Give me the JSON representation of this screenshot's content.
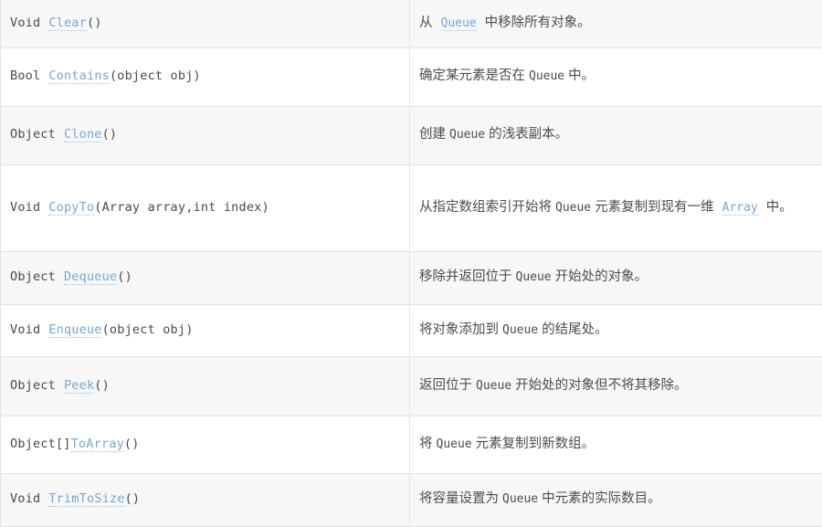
{
  "table": {
    "columns": [
      {
        "key": "signature",
        "header_visible": false
      },
      {
        "key": "description",
        "header_visible": false
      }
    ],
    "link_color": "#7aa6cf",
    "shaded_row_color": "#f7f7f7",
    "plain_row_color": "#ffffff",
    "border_color": "#e3e3e3",
    "rows": [
      {
        "return_type": "Void",
        "method_name": "Clear",
        "params": "()",
        "desc_prefix": "从",
        "desc_link": "Queue",
        "desc_suffix": "中移除所有对象。",
        "shaded": true
      },
      {
        "return_type": "Bool",
        "method_name": "Contains",
        "params": "(object obj)",
        "desc_prefix": "确定某元素是否在",
        "desc_term": "Queue",
        "desc_suffix": "中。",
        "shaded": false
      },
      {
        "return_type": "Object",
        "method_name": "Clone",
        "params": "()",
        "desc_prefix": "创建",
        "desc_term": "Queue",
        "desc_suffix": "的浅表副本。",
        "shaded": true
      },
      {
        "return_type": "Void",
        "method_name": "CopyTo",
        "params": "(Array array,int index)",
        "desc_prefix": "从指定数组索引开始将",
        "desc_term": "Queue",
        "desc_middle": "元素复制到现有一维",
        "desc_link": "Array",
        "desc_suffix": "中。",
        "shaded": false
      },
      {
        "return_type": "Object",
        "method_name": "Dequeue",
        "params": "()",
        "desc_prefix": "移除并返回位于",
        "desc_term": "Queue",
        "desc_suffix": "开始处的对象。",
        "shaded": true
      },
      {
        "return_type": "Void",
        "method_name": "Enqueue",
        "params": "(object obj)",
        "desc_prefix": "将对象添加到",
        "desc_term": "Queue",
        "desc_suffix": "的结尾处。",
        "shaded": false
      },
      {
        "return_type": "Object",
        "method_name": "Peek",
        "params": "()",
        "desc_prefix": "返回位于",
        "desc_term": "Queue",
        "desc_suffix": "开始处的对象但不将其移除。",
        "shaded": true
      },
      {
        "return_type": "Object[]",
        "method_name": "ToArray",
        "params": "()",
        "desc_prefix": "将",
        "desc_term": "Queue",
        "desc_suffix": "元素复制到新数组。",
        "shaded": false
      },
      {
        "return_type": "Void",
        "method_name": "TrimToSize",
        "params": "()",
        "desc_prefix": "将容量设置为",
        "desc_term": "Queue",
        "desc_suffix": "中元素的实际数目。",
        "shaded": true
      }
    ]
  }
}
